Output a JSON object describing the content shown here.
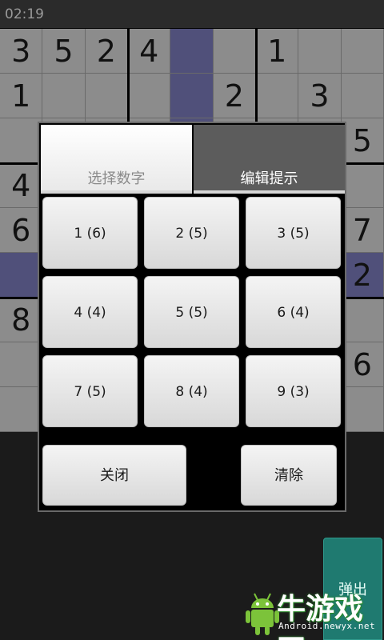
{
  "status": {
    "time": "02:19"
  },
  "board": {
    "rows": [
      [
        "3",
        "5",
        "2",
        "4",
        "",
        "",
        "1",
        "",
        ""
      ],
      [
        "1",
        "",
        "",
        "",
        "",
        "2",
        "",
        "3",
        ""
      ],
      [
        "",
        "",
        "",
        "",
        "",
        "",
        "",
        "",
        "5"
      ],
      [
        "4",
        "",
        "",
        "",
        "",
        "",
        "",
        "",
        ""
      ],
      [
        "6",
        "",
        "",
        "",
        "",
        "",
        "",
        "",
        "7"
      ],
      [
        "",
        "",
        "",
        "",
        "",
        "",
        "",
        "",
        "2"
      ],
      [
        "8",
        "",
        "",
        "",
        "",
        "",
        "",
        "",
        ""
      ],
      [
        "",
        "",
        "",
        "",
        "",
        "",
        "",
        "",
        "6"
      ],
      [
        "",
        "",
        "",
        "",
        "",
        "",
        "",
        "",
        ""
      ]
    ],
    "highlight_col": 4,
    "highlight_row": 5,
    "colors": {
      "cell": "#8c8c8c",
      "highlight": "#50507a"
    }
  },
  "dialog": {
    "tabs": {
      "select": "选择数字",
      "edit": "编辑提示"
    },
    "keys": [
      "1 (6)",
      "2 (5)",
      "3 (5)",
      "4 (4)",
      "5 (5)",
      "6 (4)",
      "7 (5)",
      "8 (4)",
      "9 (3)"
    ],
    "close_label": "关闭",
    "clear_label": "清除"
  },
  "popup_label": "弹出",
  "watermark": {
    "text": "牛游戏网",
    "url": "Android.newyx.net"
  }
}
